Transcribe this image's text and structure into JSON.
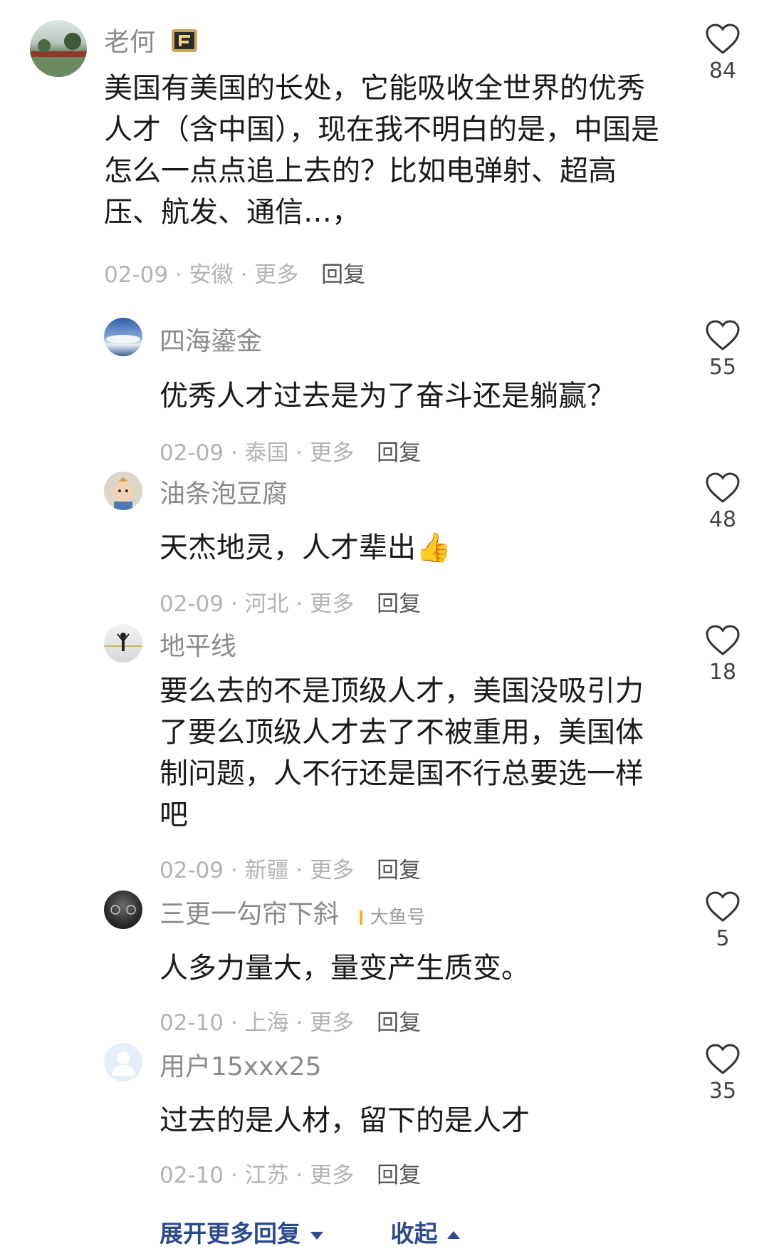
{
  "comments": [
    {
      "name": "老何",
      "text": "美国有美国的长处，它能吸收全世界的优秀人才（含中国），现在我不明白的是，中国是怎么一点点追上去的？比如电弹射、超高压、航发、通信…，",
      "date": "02-09",
      "location": "安徽",
      "more": "更多",
      "reply": "回复",
      "likes": "84",
      "avatar_icon": "avatar-landscape-icon",
      "badge_icon": "level-badge-icon"
    },
    {
      "name": "四海鎏金",
      "text": "优秀人才过去是为了奋斗还是躺赢？",
      "date": "02-09",
      "location": "泰国",
      "more": "更多",
      "reply": "回复",
      "likes": "55",
      "avatar_icon": "avatar-sky-icon"
    },
    {
      "name": "油条泡豆腐",
      "text": "天杰地灵，人才辈出👍",
      "date": "02-09",
      "location": "河北",
      "more": "更多",
      "reply": "回复",
      "likes": "48",
      "avatar_icon": "avatar-cartoon-icon"
    },
    {
      "name": "地平线",
      "text": "要么去的不是顶级人才，美国没吸引力了要么顶级人才去了不被重用，美国体制问题，人不行还是国不行总要选一样吧",
      "date": "02-09",
      "location": "新疆",
      "more": "更多",
      "reply": "回复",
      "likes": "18",
      "avatar_icon": "avatar-figure-icon"
    },
    {
      "name": "三更一勾帘下斜",
      "badge_text": "大鱼号",
      "text": "人多力量大，量变产生质变。",
      "date": "02-10",
      "location": "上海",
      "more": "更多",
      "reply": "回复",
      "likes": "5",
      "avatar_icon": "avatar-dashboard-icon"
    },
    {
      "name": "用户15xxx25",
      "text": "过去的是人材，留下的是人才",
      "date": "02-10",
      "location": "江苏",
      "more": "更多",
      "reply": "回复",
      "likes": "35",
      "avatar_icon": "avatar-default-user-icon"
    }
  ],
  "footer": {
    "expand_label": "展开更多回复",
    "collapse_label": "收起"
  },
  "colors": {
    "link": "#2d4a8a",
    "meta": "#b3b3b3",
    "name": "#8a8a8a"
  }
}
